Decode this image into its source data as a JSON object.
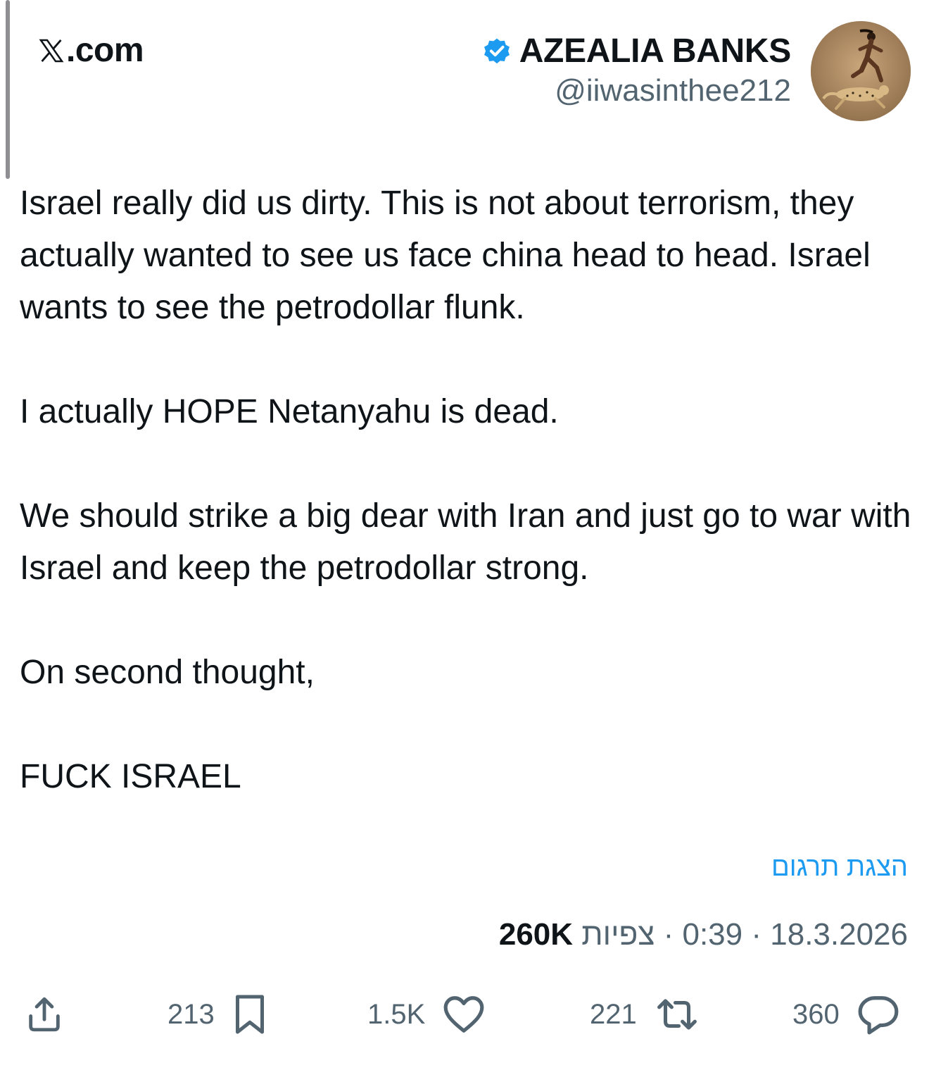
{
  "header": {
    "site_label": ".com",
    "author_name": "AZEALIA BANKS",
    "author_handle": "@iiwasinthee212"
  },
  "tweet": {
    "paragraphs": [
      "Israel really did us dirty. This is not about terrorism, they actually wanted to see us face china head to head. Israel wants to see the petrodollar flunk.",
      "I actually HOPE Netanyahu is dead.",
      "We should strike a big dear with Iran and just go to war with Israel and keep the petrodollar strong.",
      "On second thought,",
      "FUCK ISRAEL"
    ],
    "translate_label": "הצגת תרגום",
    "date": "18.3.2026",
    "time": "0:39",
    "separator": "·",
    "views_label": "צפיות",
    "views_count": "260K"
  },
  "actions": {
    "bookmarks": "213",
    "likes": "1.5K",
    "reposts": "221",
    "replies": "360"
  },
  "icons": {
    "logo": "x-logo-icon",
    "verified": "verified-badge-icon",
    "share": "share-icon",
    "bookmark": "bookmark-icon",
    "like": "heart-icon",
    "repost": "repost-icon",
    "reply": "reply-icon"
  },
  "colors": {
    "accent": "#1d9bf0",
    "muted": "#536471",
    "text": "#0f1419"
  }
}
